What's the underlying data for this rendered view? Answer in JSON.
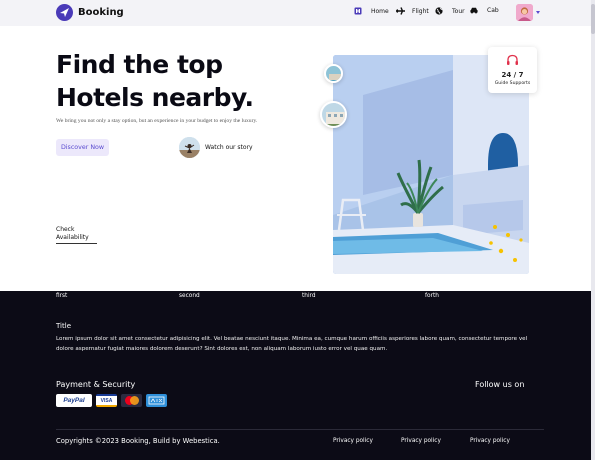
{
  "brand": {
    "name": "Booking",
    "accent": "#4a3ab8"
  },
  "nav": {
    "items": [
      {
        "label": "Home",
        "icon": "hotel-icon"
      },
      {
        "label": "Flight",
        "icon": "plane-icon"
      },
      {
        "label": "Tour",
        "icon": "globe-icon"
      },
      {
        "label": "Cab",
        "icon": "car-icon"
      }
    ],
    "avatar": "user-avatar"
  },
  "hero": {
    "title_line1": "Find the top",
    "title_line2": "Hotels nearby.",
    "description": "We bring you not only a stay option, but an experience in your budget to enjoy the luxury.",
    "discover_label": "Discover Now",
    "watch_label": "Watch our story",
    "check_line1": "Check",
    "check_line2": "Availability"
  },
  "support": {
    "value": "24 / 7",
    "label": "Guide Supports",
    "icon": "headset-icon"
  },
  "footer": {
    "tabs": [
      "first",
      "second",
      "third",
      "forth"
    ],
    "title": "Title",
    "body": "Lorem ipsum dolor sit amet consectetur adipisicing elit. Vel beatae nesciunt itaque. Minima ea, cumque harum officiis asperiores labore quam, consectetur tempore vel dolore aspernatur fugiat maiores dolorem deserunt? Sint dolores est, non aliquam laborum iusto error vel quae quam.",
    "payment_heading": "Payment & Security",
    "payment_methods": [
      "PayPal",
      "VISA",
      "MasterCard",
      "Amex"
    ],
    "follow_heading": "Follow us on",
    "copyright": "Copyrights ©2023 Booking, Build by Webestica.",
    "links": [
      "Privacy policy",
      "Privacy policy",
      "Privacy policy"
    ]
  }
}
